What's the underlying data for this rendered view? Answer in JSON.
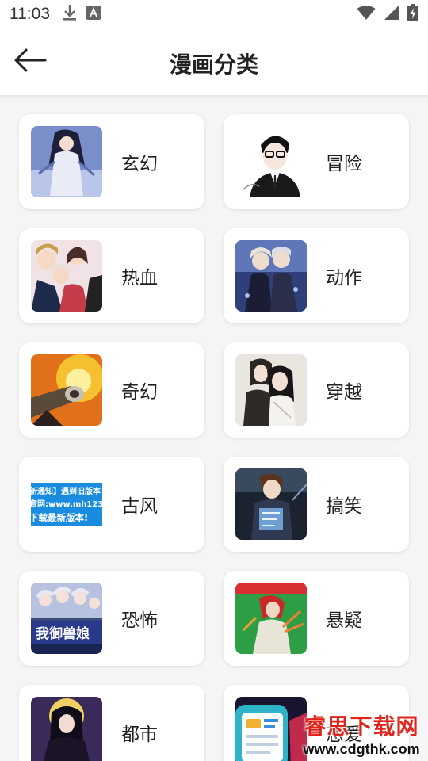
{
  "status_bar": {
    "time": "11:03",
    "icons": [
      "download-icon",
      "font-a-icon",
      "wifi-icon",
      "signal-icon",
      "battery-charging-icon"
    ]
  },
  "header": {
    "back_icon": "arrow-left-icon",
    "title": "漫画分类"
  },
  "categories": [
    {
      "label": "玄幻",
      "thumb": "fantasy-cover"
    },
    {
      "label": "冒险",
      "thumb": "adventure-cover"
    },
    {
      "label": "热血",
      "thumb": "hotblood-cover"
    },
    {
      "label": "动作",
      "thumb": "action-cover"
    },
    {
      "label": "奇幻",
      "thumb": "magic-cover"
    },
    {
      "label": "穿越",
      "thumb": "timetravel-cover"
    },
    {
      "label": "古风",
      "thumb": "notice-banner",
      "thumb_lines": [
        "新通知】遇到旧版本",
        "官网:www.mh123",
        "下载最新版本!"
      ]
    },
    {
      "label": "搞笑",
      "thumb": "comedy-cover"
    },
    {
      "label": "恐怖",
      "thumb": "horror-cover",
      "thumb_lines": [
        "我御兽娘"
      ]
    },
    {
      "label": "悬疑",
      "thumb": "mystery-cover"
    },
    {
      "label": "都市",
      "thumb": "urban-cover"
    },
    {
      "label": "恋爱",
      "thumb": "romance-cover"
    }
  ],
  "watermark": {
    "title": "睿思下载网",
    "url": "www.cdgthk.com"
  },
  "colors": {
    "background": "#f5f5f5",
    "card": "#ffffff",
    "text": "#222222",
    "watermark_red": "#e2231a"
  }
}
